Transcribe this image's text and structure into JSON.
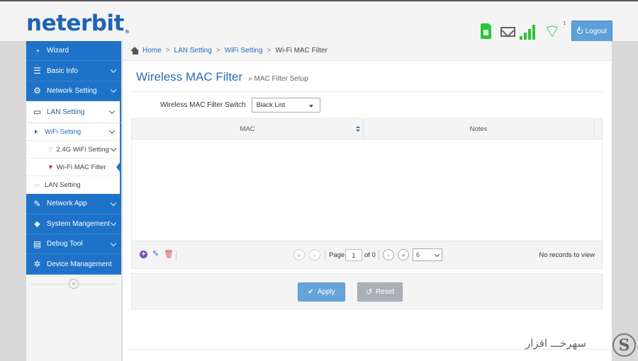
{
  "brand": {
    "logo_text": "neterbit",
    "logo_reg": "®",
    "color": "#1f64b4"
  },
  "header": {
    "status_icons": [
      "sim-card-icon",
      "mail-icon",
      "signal-strength-icon",
      "wifi-icon"
    ],
    "wifi_count": "1",
    "logout_label": "Logout"
  },
  "sidebar": {
    "items": [
      {
        "label": "Wizard",
        "icon": "◔"
      },
      {
        "label": "Basic Info",
        "icon": "☰"
      },
      {
        "label": "Network Setting",
        "icon": "⚙"
      },
      {
        "label": "LAN Setting",
        "icon": "▭"
      },
      {
        "label": "Network App",
        "icon": "✎"
      },
      {
        "label": "System Mangement",
        "icon": "⬥"
      },
      {
        "label": "Debug Tool",
        "icon": "▤"
      },
      {
        "label": "Device Management",
        "icon": "✲"
      }
    ],
    "sub": {
      "wifi_setting": "WiFi Setting",
      "wifi_24g": "2.4G WiFi Setting",
      "wifi_mac_filter": "Wi-Fi MAC Filter",
      "lan_setting": "LAN Setting"
    },
    "collapse_label": "«"
  },
  "breadcrumb": {
    "home": "Home",
    "items": [
      "LAN Setting",
      "WiFi Setting"
    ],
    "current": "Wi-Fi MAC Filter",
    "separator": ">"
  },
  "page": {
    "title": "Wireless MAC Filter",
    "subtitle": "» MAC Filter Setup"
  },
  "filter_switch": {
    "label": "Wireless MAC Filter Switch",
    "value": "Black List"
  },
  "grid": {
    "columns": [
      "MAC",
      "Notes"
    ],
    "rows": []
  },
  "pager": {
    "page_label": "Page",
    "page_value": "1",
    "of_label": "of 0",
    "rows_per_page": "6",
    "records_text": "No records to view",
    "first": "«",
    "prev": "‹",
    "next": "›",
    "last": "»"
  },
  "actions": {
    "apply_label": "Apply",
    "reset_label": "Reset"
  },
  "watermark": {
    "text": "سهرخـــ افزار",
    "letter": "S"
  }
}
